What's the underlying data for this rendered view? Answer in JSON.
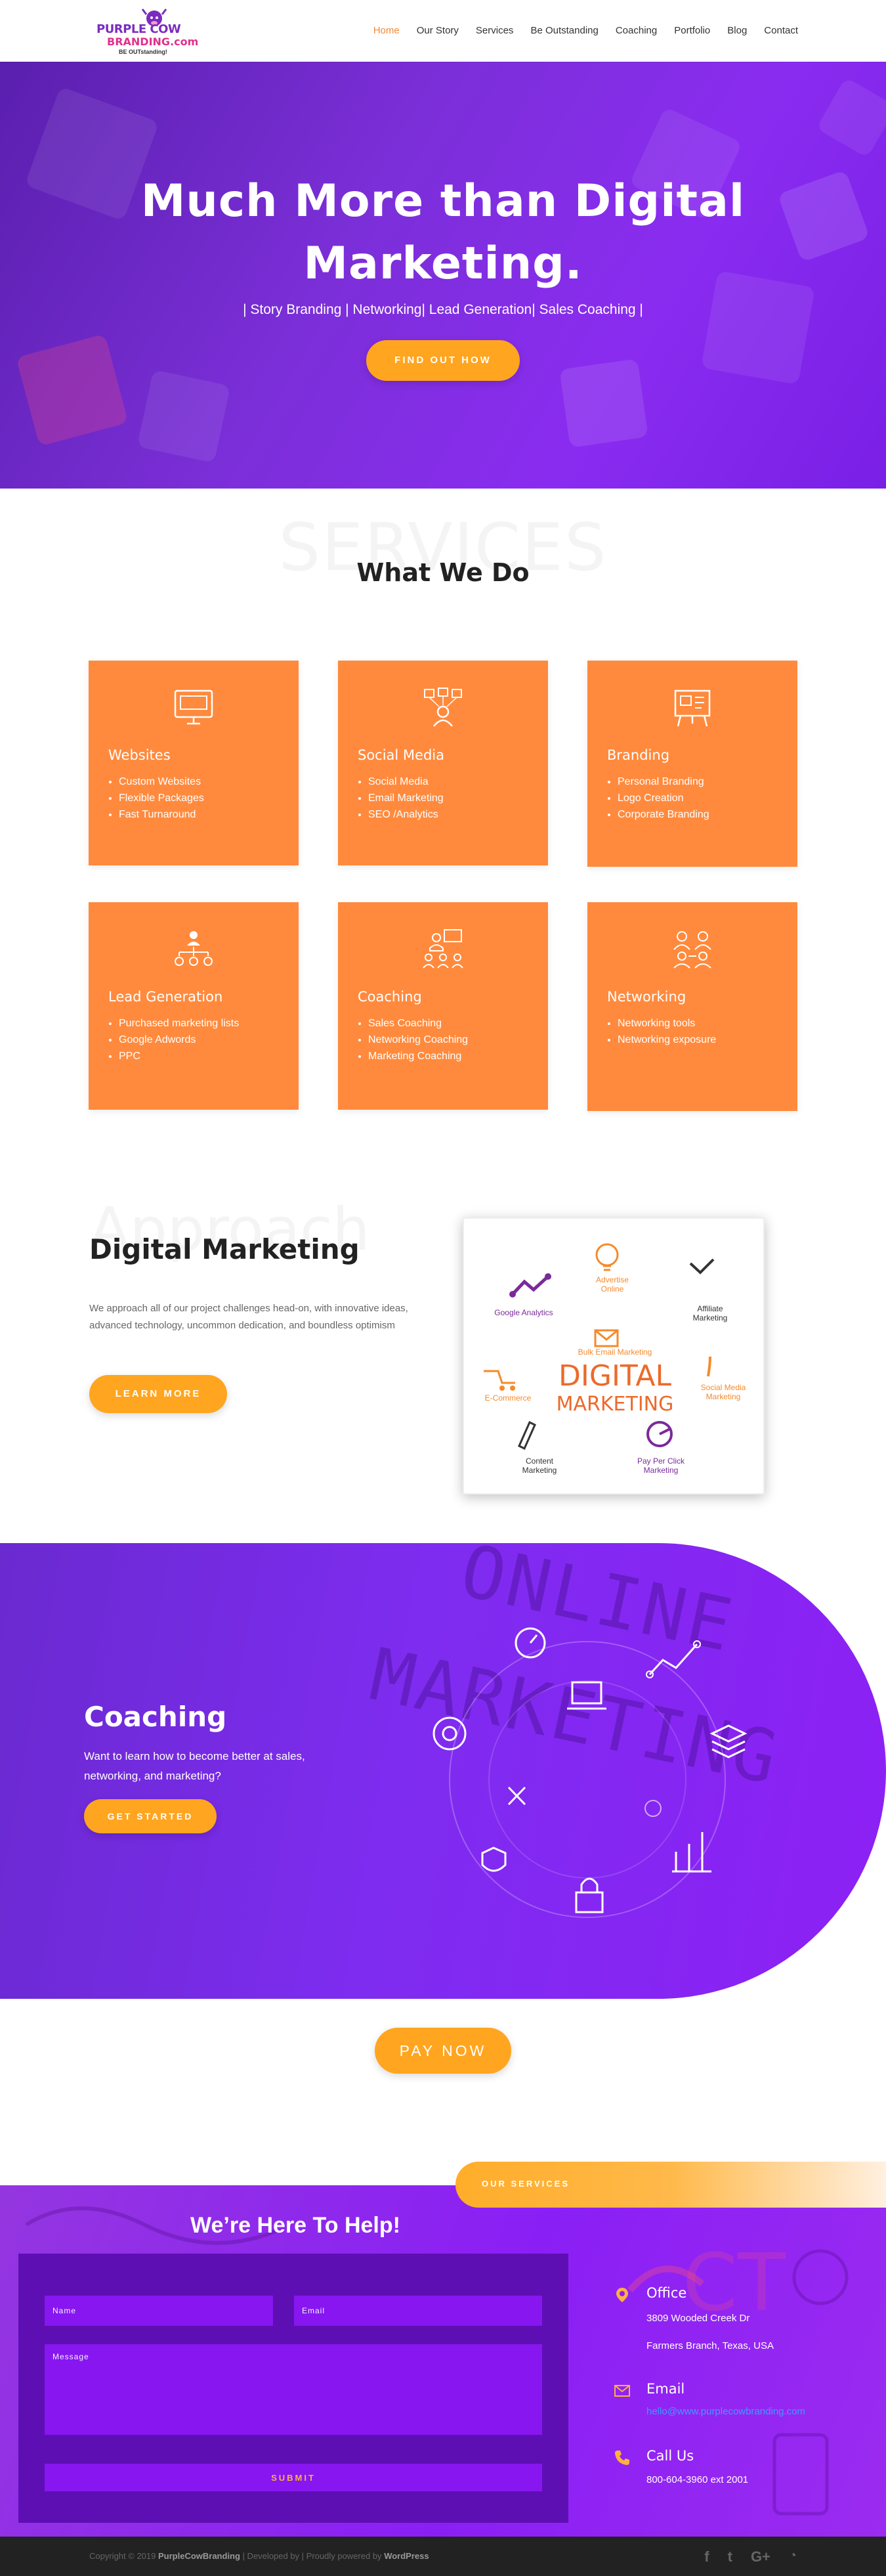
{
  "header": {
    "logo_line1": "PURPLE COW",
    "logo_line2": "BRANDING.com",
    "logo_tagline": "BE OUTstanding!",
    "nav": [
      "Home",
      "Our Story",
      "Services",
      "Be Outstanding",
      "Coaching",
      "Portfolio",
      "Blog",
      "Contact"
    ],
    "active": "Home"
  },
  "hero": {
    "title": "Much More than Digital Marketing.",
    "subtitle": "| Story Branding | Networking| Lead Generation| Sales Coaching |",
    "button": "FIND OUT HOW"
  },
  "services": {
    "ghost": "SERVICES",
    "title": "What We Do",
    "cards": [
      {
        "title": "Websites",
        "icon": "website-icon",
        "items": [
          "Custom Websites",
          "Flexible Packages",
          "Fast Turnaround"
        ]
      },
      {
        "title": "Social Media",
        "icon": "social-media-icon",
        "items": [
          "Social Media",
          "Email Marketing",
          "SEO /Analytics"
        ]
      },
      {
        "title": "Branding",
        "icon": "branding-icon",
        "items": [
          "Personal Branding",
          "Logo Creation",
          "Corporate Branding"
        ]
      },
      {
        "title": "Lead Generation",
        "icon": "lead-generation-icon",
        "items": [
          "Purchased marketing lists",
          "Google Adwords",
          "PPC"
        ]
      },
      {
        "title": "Coaching",
        "icon": "coaching-icon",
        "items": [
          "Sales Coaching",
          "Networking Coaching",
          "Marketing Coaching"
        ]
      },
      {
        "title": "Networking",
        "icon": "networking-icon",
        "items": [
          "Networking tools",
          "Networking exposure"
        ]
      }
    ]
  },
  "digital_marketing": {
    "ghost": "Approach",
    "title": "Digital Marketing",
    "text": "We approach all of our project challenges head-on, with innovative ideas, advanced technology, uncommon dedication, and boundless optimism",
    "button": "LEARN MORE",
    "image": {
      "center_line1": "DIGITAL",
      "center_line2": "MARKETING",
      "labels": [
        "Advertise Online",
        "Affiliate Marketing",
        "Social Media Marketing",
        "Pay Per Click Marketing",
        "Content Marketing",
        "E-Commerce",
        "Google Analytics",
        "Bulk Email Marketing"
      ]
    }
  },
  "coaching": {
    "title": "Coaching",
    "text": "Want to learn how to become better at sales, networking, and marketing?",
    "button": "GET STARTED",
    "bg_words": [
      "ONLINE",
      "MARKETING"
    ]
  },
  "pay_button": "PAY NOW",
  "contact": {
    "tab": "OUR SERVICES",
    "title": "We’re Here To Help!",
    "form": {
      "name_placeholder": "Name",
      "email_placeholder": "Email",
      "message_placeholder": "Message",
      "submit": "SUBMIT"
    },
    "office": {
      "heading": "Office",
      "line1": "3809 Wooded Creek Dr",
      "line2": "Farmers Branch, Texas, USA"
    },
    "email": {
      "heading": "Email",
      "value": "hello@www.purplecowbranding.com"
    },
    "phone": {
      "heading": "Call Us",
      "value": "800-604-3960 ext 2001"
    }
  },
  "footer": {
    "copyright_prefix": "Copyright © 2019",
    "brand": "PurpleCowBranding",
    "middle": "| Developed by | Proudly powered by",
    "wp": "WordPress",
    "social": [
      "f",
      "t",
      "G+",
      "rss"
    ]
  },
  "colors": {
    "purple": "#8a2cf0",
    "orange": "#ff8a3d",
    "button_orange": "#ffa51f",
    "nav_active": "#f28b36"
  }
}
